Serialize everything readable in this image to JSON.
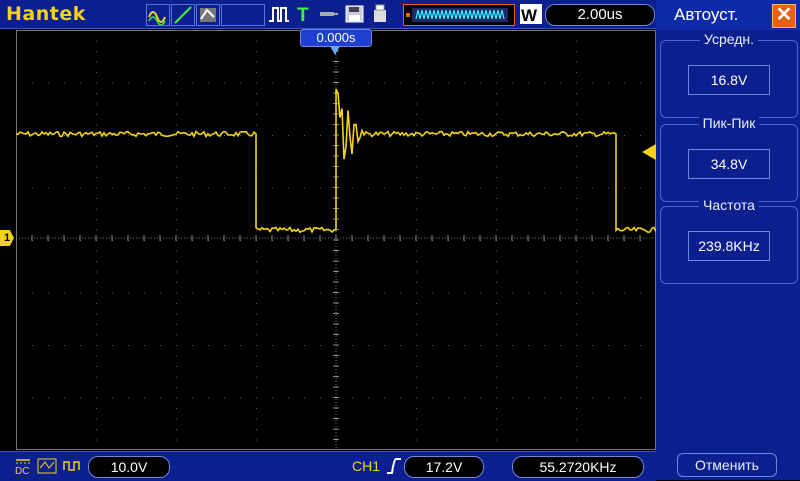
{
  "brand": "Hantek",
  "timebase": "2.00us",
  "trigger_position": "0.000s",
  "channel_marker": "1",
  "side_panel": {
    "title": "Автоуст.",
    "groups": [
      {
        "label": "Усредн.",
        "value": "16.8V"
      },
      {
        "label": "Пик-Пик",
        "value": "34.8V"
      },
      {
        "label": "Частота",
        "value": "239.8KHz"
      }
    ],
    "cancel_label": "Отменить"
  },
  "bottom": {
    "volts_div": "10.0V",
    "trigger_source": "CH1",
    "trigger_level": "17.2V",
    "frequency": "55.2720KHz"
  },
  "colors": {
    "trace": "#f2d21b",
    "panel": "#0b1f8f",
    "grid": "#5a5a5a"
  },
  "waveform": {
    "levels_divisions": {
      "high": 1.95,
      "low": 0.2
    },
    "segments_x_divisions": [
      {
        "from": 0,
        "to": 3.0,
        "level": "high"
      },
      {
        "from": 3.0,
        "to": 4.0,
        "level": "low"
      },
      {
        "from": 4.0,
        "to": 7.5,
        "level": "high"
      },
      {
        "from": 7.5,
        "to": 8.0,
        "level": "low"
      }
    ],
    "grid_divisions": {
      "x": 8,
      "y": 8
    }
  }
}
